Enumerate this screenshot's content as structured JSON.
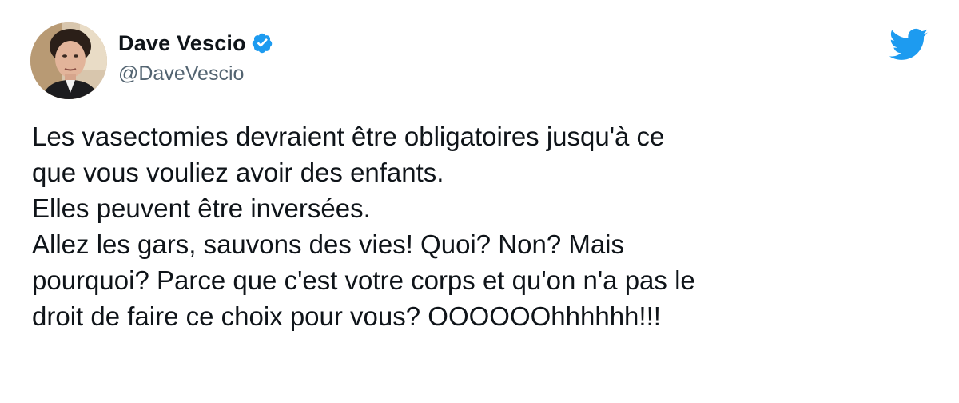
{
  "tweet": {
    "author": {
      "display_name": "Dave Vescio",
      "handle": "@DaveVescio",
      "verified": true,
      "avatar_icon": "profile-photo"
    },
    "brand_icon": "twitter-bird-icon",
    "brand_color": "#1d9bf0",
    "text_lines": [
      "Les vasectomies devraient être obligatoires jusqu'à ce",
      "que vous vouliez avoir des enfants.",
      "Elles peuvent être inversées.",
      "Allez les gars, sauvons des vies! Quoi? Non? Mais",
      "pourquoi? Parce que c'est votre corps et qu'on n'a pas le",
      "droit de faire ce choix pour vous? OOOOOOhhhhhh!!!"
    ]
  }
}
